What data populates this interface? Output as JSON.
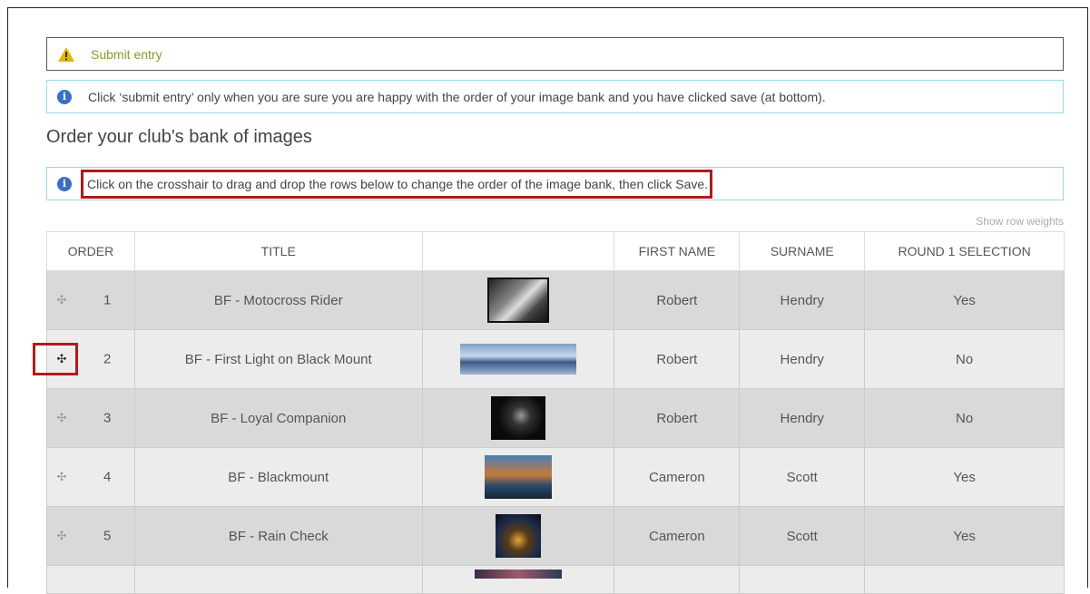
{
  "alerts": {
    "submit_label": "Submit entry",
    "info_text": "Click ‘submit entry’ only when you are sure you are happy with the order of your image bank and you have clicked save (at bottom).",
    "drag_text": "Click on the crosshair to drag and drop the rows below to change the order of the image bank, then click Save."
  },
  "page": {
    "heading": "Order your club's bank of images",
    "show_row_weights": "Show row weights"
  },
  "table": {
    "headers": [
      "ORDER",
      "TITLE",
      "",
      "FIRST NAME",
      "SURNAME",
      "ROUND 1 SELECTION"
    ],
    "rows": [
      {
        "order": "1",
        "title": "BF - Motocross Rider",
        "first": "Robert",
        "surname": "Hendry",
        "selection": "Yes"
      },
      {
        "order": "2",
        "title": "BF - First Light on Black Mount",
        "first": "Robert",
        "surname": "Hendry",
        "selection": "No"
      },
      {
        "order": "3",
        "title": "BF - Loyal Companion",
        "first": "Robert",
        "surname": "Hendry",
        "selection": "No"
      },
      {
        "order": "4",
        "title": "BF - Blackmount",
        "first": "Cameron",
        "surname": "Scott",
        "selection": "Yes"
      },
      {
        "order": "5",
        "title": "BF - Rain Check",
        "first": "Cameron",
        "surname": "Scott",
        "selection": "Yes"
      }
    ]
  },
  "icons": {
    "warning": "warning-icon",
    "info": "info-icon",
    "drag": "crosshair-drag-icon"
  },
  "colors": {
    "highlight": "#b01a1a",
    "info_border": "#9bd8e6",
    "info_icon": "#3a6fc4",
    "warning_icon": "#e8b400"
  }
}
